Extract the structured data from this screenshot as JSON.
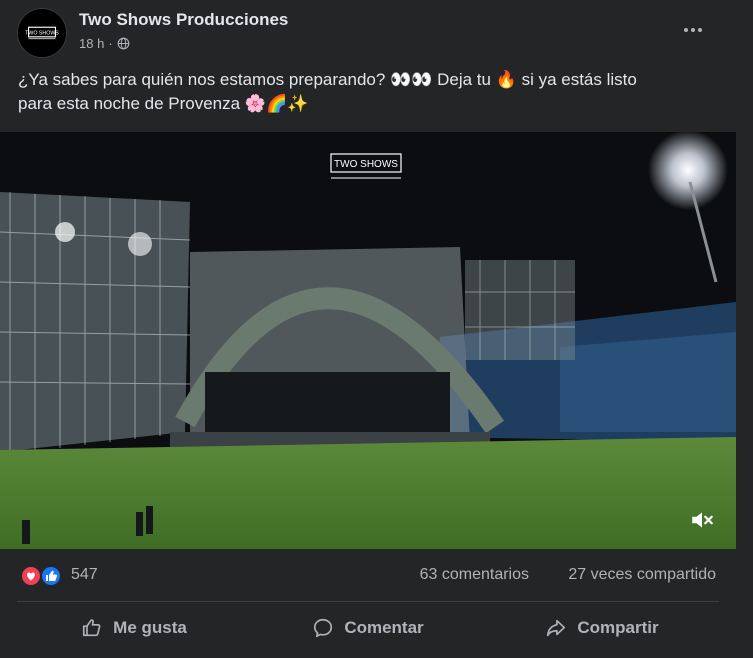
{
  "post": {
    "page_name": "Two Shows Producciones",
    "timestamp": "18 h",
    "separator": "·",
    "audience_icon": "globe-icon",
    "more_icon": "more-options-icon",
    "caption_line1": "¿Ya sabes para quién nos estamos preparando? 👀👀 Deja tu 🔥 si ya estás listo",
    "caption_line2": "para esta noche de Provenza 🌸🌈✨"
  },
  "avatar": {
    "logo_text": "TWO SHOWS"
  },
  "video": {
    "watermark_text": "TWO SHOWS",
    "mute_icon": "speaker-muted-icon",
    "scene_description_colors": {
      "sky": "#0b0d10",
      "grass": "#3f7a2a",
      "stage": "#6b7a6e"
    }
  },
  "stats": {
    "reaction_icons": [
      "love-reaction-icon",
      "like-reaction-icon"
    ],
    "reaction_count": "547",
    "comments": "63 comentarios",
    "shares": "27 veces compartido"
  },
  "actions": {
    "like_label": "Me gusta",
    "comment_label": "Comentar",
    "share_label": "Compartir"
  },
  "colors": {
    "background": "#242526",
    "text_primary": "#e4e6eb",
    "text_secondary": "#b0b3b8",
    "like_blue": "#1877f2",
    "love_red": "#f33e58"
  }
}
